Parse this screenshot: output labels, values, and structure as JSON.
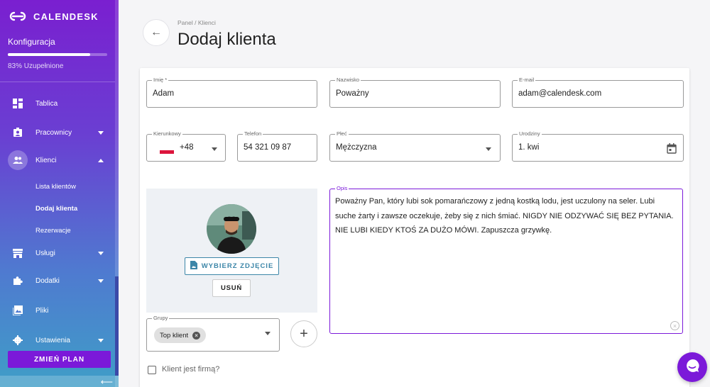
{
  "brand": {
    "name": "CALENDESK"
  },
  "setup": {
    "title": "Konfiguracja",
    "progress_percent": 83,
    "progress_text": "83% Uzupełnione"
  },
  "sidebar": {
    "items": [
      {
        "label": "Tablica",
        "icon": "dashboard-icon"
      },
      {
        "label": "Pracownicy",
        "icon": "employees-icon"
      },
      {
        "label": "Klienci",
        "icon": "clients-icon"
      },
      {
        "label": "Usługi",
        "icon": "services-icon"
      },
      {
        "label": "Dodatki",
        "icon": "addons-icon"
      },
      {
        "label": "Pliki",
        "icon": "files-icon"
      },
      {
        "label": "Ustawienia",
        "icon": "settings-icon"
      }
    ],
    "sub_items": [
      {
        "label": "Lista klientów"
      },
      {
        "label": "Dodaj klienta"
      },
      {
        "label": "Rezerwacje"
      }
    ],
    "plan_button": "ZMIEŃ PLAN"
  },
  "header": {
    "breadcrumb": "Panel / Klienci",
    "title": "Dodaj klienta"
  },
  "form": {
    "first_name": {
      "label": "Imię *",
      "value": "Adam"
    },
    "last_name": {
      "label": "Nazwisko",
      "value": "Poważny"
    },
    "email": {
      "label": "E-mail",
      "value": "adam@calendesk.com"
    },
    "dial_code": {
      "label": "Kierunkowy",
      "value": "+48"
    },
    "phone": {
      "label": "Telefon",
      "value": "54 321 09 87"
    },
    "gender": {
      "label": "Płeć",
      "value": "Mężczyzna"
    },
    "birthday": {
      "label": "Urodziny",
      "value": "1. kwi"
    },
    "description": {
      "label": "Opis",
      "value": "Poważny Pan, który lubi sok pomarańczowy z jedną kostką lodu, jest uczulony na seler. Lubi suche żarty i zawsze oczekuje, żeby się z nich śmiać. NIGDY NIE ODZYWAĆ SIĘ BEZ PYTANIA. NIE LUBI KIEDY KTOŚ ZA DUŻO MÓWI. Zapuszcza grzywkę."
    },
    "choose_photo": "WYBIERZ ZDJĘCIE",
    "remove_photo": "USUŃ",
    "groups": {
      "label": "Grupy",
      "chips": [
        "Top klient"
      ]
    },
    "company_checkbox": "Klient jest firmą?"
  },
  "colors": {
    "accent": "#7b19d9",
    "secondary": "#3c86a8"
  }
}
